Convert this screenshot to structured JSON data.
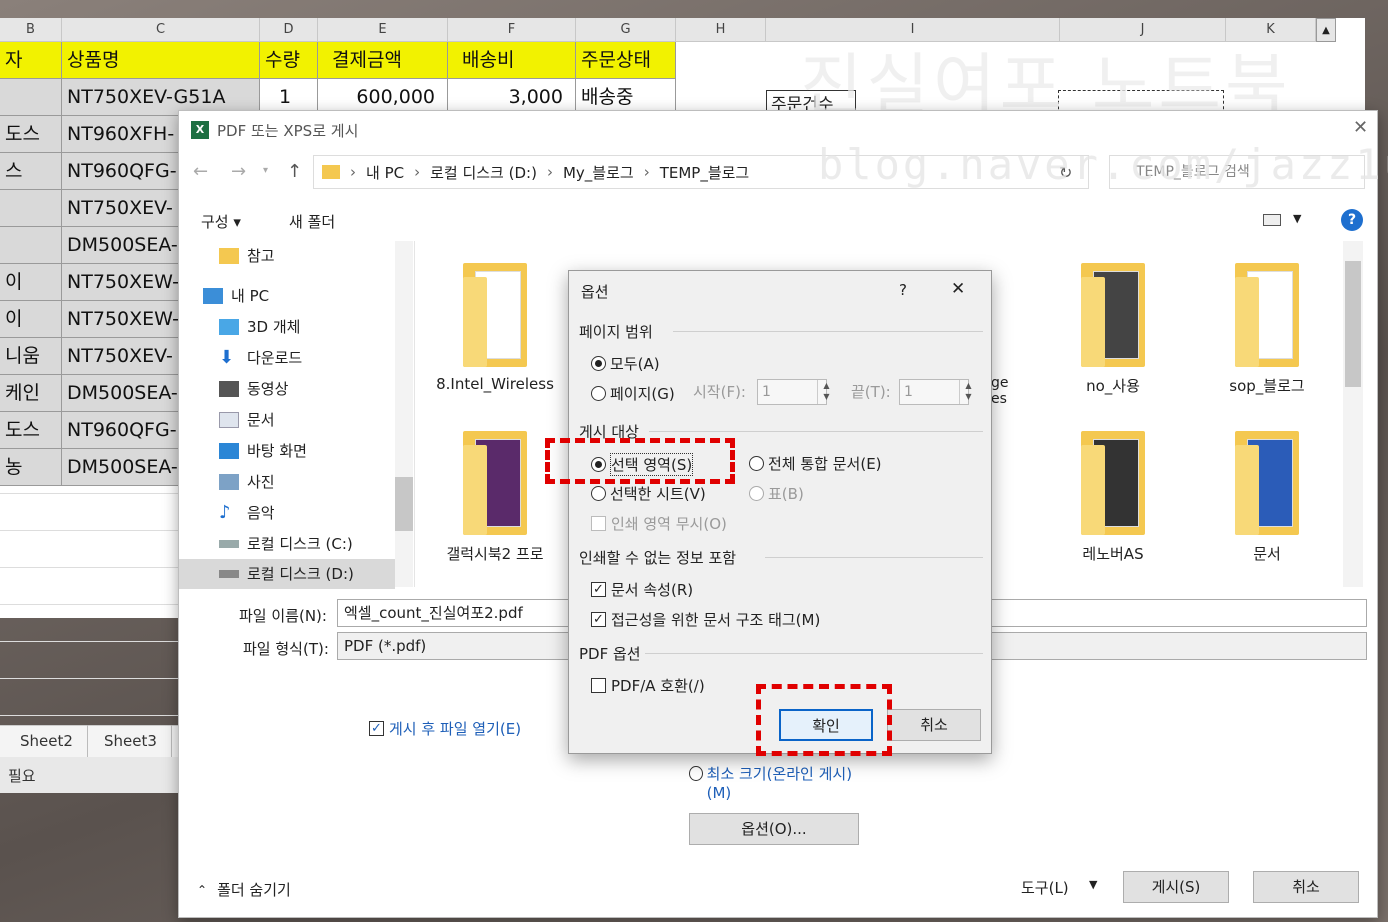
{
  "excel": {
    "col_headers": [
      "B",
      "C",
      "D",
      "E",
      "F",
      "G",
      "H",
      "I",
      "J",
      "K"
    ],
    "header_row": {
      "b": "자",
      "c": "상품명",
      "d": "수량",
      "e": "결제금액",
      "f": "배송비",
      "g": "주문상태"
    },
    "rows": [
      {
        "b": "",
        "c": "NT750XEV-G51A",
        "d": "1",
        "e": "600,000",
        "f": "3,000",
        "g": "배송중"
      },
      {
        "b": "도스",
        "c": "NT960XFH-",
        "d": "",
        "e": "",
        "f": "",
        "g": ""
      },
      {
        "b": "스",
        "c": "NT960QFG-",
        "d": "",
        "e": "",
        "f": "",
        "g": ""
      },
      {
        "b": "",
        "c": "NT750XEV-",
        "d": "",
        "e": "",
        "f": "",
        "g": ""
      },
      {
        "b": "",
        "c": "DM500SEA-",
        "d": "",
        "e": "",
        "f": "",
        "g": ""
      },
      {
        "b": "이",
        "c": "NT750XEW-",
        "d": "",
        "e": "",
        "f": "",
        "g": ""
      },
      {
        "b": "이",
        "c": "NT750XEW-",
        "d": "",
        "e": "",
        "f": "",
        "g": ""
      },
      {
        "b": "니움",
        "c": "NT750XEV-",
        "d": "",
        "e": "",
        "f": "",
        "g": ""
      },
      {
        "b": "케인",
        "c": "DM500SEA-",
        "d": "",
        "e": "",
        "f": "",
        "g": ""
      },
      {
        "b": "도스",
        "c": "NT960QFG-",
        "d": "",
        "e": "",
        "f": "",
        "g": ""
      },
      {
        "b": "농",
        "c": "DM500SEA-",
        "d": "",
        "e": "",
        "f": "",
        "g": ""
      }
    ],
    "side_label": "주문건수",
    "sheet_tabs": [
      "Sheet2",
      "Sheet3"
    ],
    "status": "필요",
    "watermark_line1": "진실여포 노트북",
    "watermark_line2": "blog.naver.com/jazz1ub"
  },
  "dialog": {
    "title": "PDF 또는 XPS로 게시",
    "close": "✕",
    "breadcrumb": [
      "내 PC",
      "로컬 디스크 (D:)",
      "My_블로그",
      "TEMP_블로그"
    ],
    "search_placeholder": "TEMP_블로그 검색",
    "toolbar": {
      "organize": "구성 ▾",
      "new_folder": "새 폴더"
    },
    "nav": [
      "참고",
      "내 PC",
      "3D 개체",
      "다운로드",
      "동영상",
      "문서",
      "바탕 화면",
      "사진",
      "음악",
      "로컬 디스크 (C:)",
      "로컬 디스크 (D:)"
    ],
    "folders": [
      {
        "label": "8.Intel_Wireless"
      },
      {
        "label": "no_사용"
      },
      {
        "label": "sop_블로그"
      },
      {
        "label": "갤럭시북2 프로"
      },
      {
        "label": "레노버AS"
      },
      {
        "label": "문서"
      }
    ],
    "partial_label": "ge\nes",
    "filename_label": "파일 이름(N):",
    "filename_value": "엑셀_count_진실여포2.pdf",
    "filetype_label": "파일 형식(T):",
    "filetype_value": "PDF (*.pdf)",
    "open_after": "게시 후 파일 열기(E)",
    "min_size": "최소 크기(온라인 게시)(M)",
    "options_button": "옵션(O)...",
    "hide_folders": "폴더 숨기기",
    "tools": "도구(L)",
    "publish": "게시(S)",
    "cancel": "취소"
  },
  "options": {
    "title": "옵션",
    "help": "?",
    "close": "✕",
    "page_range": "페이지 범위",
    "all": "모두(A)",
    "pages": "페이지(G)",
    "from_label": "시작(F):",
    "from_value": "1",
    "to_label": "끝(T):",
    "to_value": "1",
    "publish_what": "게시 대상",
    "selection": "선택 영역(S)",
    "entire_workbook": "전체 통합 문서(E)",
    "active_sheets": "선택한 시트(V)",
    "table": "표(B)",
    "ignore_print_areas": "인쇄 영역 무시(O)",
    "nonprint_info": "인쇄할 수 없는 정보 포함",
    "doc_props": "문서 속성(R)",
    "struct_tags": "접근성을 위한 문서 구조 태그(M)",
    "pdf_options": "PDF 옵션",
    "pdfa": "PDF/A 호환(/)",
    "ok": "확인",
    "cancel": "취소"
  }
}
